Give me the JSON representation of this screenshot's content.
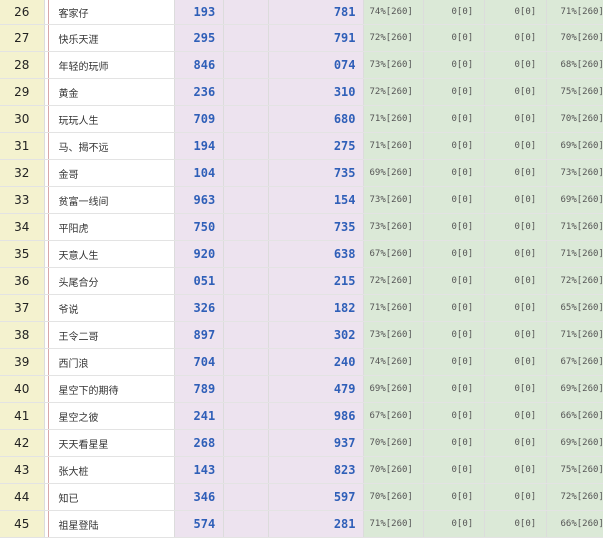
{
  "rows": [
    {
      "rank": "26",
      "name": "客家仔",
      "num_a": "193",
      "num_b": "781",
      "pct1": "74%[260]",
      "zero1": "0[0]",
      "zero2": "0[0]",
      "pct4": "71%[260]"
    },
    {
      "rank": "27",
      "name": "快乐天涯",
      "num_a": "295",
      "num_b": "791",
      "pct1": "72%[260]",
      "zero1": "0[0]",
      "zero2": "0[0]",
      "pct4": "70%[260]"
    },
    {
      "rank": "28",
      "name": "年轻的玩师",
      "num_a": "846",
      "num_b": "074",
      "pct1": "73%[260]",
      "zero1": "0[0]",
      "zero2": "0[0]",
      "pct4": "68%[260]"
    },
    {
      "rank": "29",
      "name": "黄金",
      "num_a": "236",
      "num_b": "310",
      "pct1": "72%[260]",
      "zero1": "0[0]",
      "zero2": "0[0]",
      "pct4": "75%[260]"
    },
    {
      "rank": "30",
      "name": "玩玩人生",
      "num_a": "709",
      "num_b": "680",
      "pct1": "71%[260]",
      "zero1": "0[0]",
      "zero2": "0[0]",
      "pct4": "70%[260]"
    },
    {
      "rank": "31",
      "name": "马、揭不远",
      "num_a": "194",
      "num_b": "275",
      "pct1": "71%[260]",
      "zero1": "0[0]",
      "zero2": "0[0]",
      "pct4": "69%[260]"
    },
    {
      "rank": "32",
      "name": "金哥",
      "num_a": "104",
      "num_b": "735",
      "pct1": "69%[260]",
      "zero1": "0[0]",
      "zero2": "0[0]",
      "pct4": "73%[260]"
    },
    {
      "rank": "33",
      "name": "贫富一线间",
      "num_a": "963",
      "num_b": "154",
      "pct1": "73%[260]",
      "zero1": "0[0]",
      "zero2": "0[0]",
      "pct4": "69%[260]"
    },
    {
      "rank": "34",
      "name": "平阳虎",
      "num_a": "750",
      "num_b": "735",
      "pct1": "73%[260]",
      "zero1": "0[0]",
      "zero2": "0[0]",
      "pct4": "71%[260]"
    },
    {
      "rank": "35",
      "name": "天意人生",
      "num_a": "920",
      "num_b": "638",
      "pct1": "67%[260]",
      "zero1": "0[0]",
      "zero2": "0[0]",
      "pct4": "71%[260]"
    },
    {
      "rank": "36",
      "name": "头尾合分",
      "num_a": "051",
      "num_b": "215",
      "pct1": "72%[260]",
      "zero1": "0[0]",
      "zero2": "0[0]",
      "pct4": "72%[260]"
    },
    {
      "rank": "37",
      "name": "爷说",
      "num_a": "326",
      "num_b": "182",
      "pct1": "71%[260]",
      "zero1": "0[0]",
      "zero2": "0[0]",
      "pct4": "65%[260]"
    },
    {
      "rank": "38",
      "name": "王令二哥",
      "num_a": "897",
      "num_b": "302",
      "pct1": "73%[260]",
      "zero1": "0[0]",
      "zero2": "0[0]",
      "pct4": "71%[260]"
    },
    {
      "rank": "39",
      "name": "西门浪",
      "num_a": "704",
      "num_b": "240",
      "pct1": "74%[260]",
      "zero1": "0[0]",
      "zero2": "0[0]",
      "pct4": "67%[260]"
    },
    {
      "rank": "40",
      "name": "星空下的期待",
      "num_a": "789",
      "num_b": "479",
      "pct1": "69%[260]",
      "zero1": "0[0]",
      "zero2": "0[0]",
      "pct4": "69%[260]"
    },
    {
      "rank": "41",
      "name": "星空之彼",
      "num_a": "241",
      "num_b": "986",
      "pct1": "67%[260]",
      "zero1": "0[0]",
      "zero2": "0[0]",
      "pct4": "66%[260]"
    },
    {
      "rank": "42",
      "name": "天天看星星",
      "num_a": "268",
      "num_b": "937",
      "pct1": "70%[260]",
      "zero1": "0[0]",
      "zero2": "0[0]",
      "pct4": "69%[260]"
    },
    {
      "rank": "43",
      "name": "张大桩",
      "num_a": "143",
      "num_b": "823",
      "pct1": "70%[260]",
      "zero1": "0[0]",
      "zero2": "0[0]",
      "pct4": "75%[260]"
    },
    {
      "rank": "44",
      "name": "知已",
      "num_a": "346",
      "num_b": "597",
      "pct1": "70%[260]",
      "zero1": "0[0]",
      "zero2": "0[0]",
      "pct4": "72%[260]"
    },
    {
      "rank": "45",
      "name": "祖星登陆",
      "num_a": "574",
      "num_b": "281",
      "pct1": "71%[260]",
      "zero1": "0[0]",
      "zero2": "0[0]",
      "pct4": "66%[260]"
    }
  ]
}
